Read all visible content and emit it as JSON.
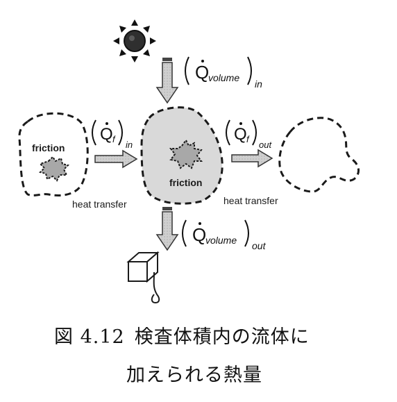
{
  "labels": {
    "friction_left": "friction",
    "friction_center": "friction",
    "heat_transfer_left": "heat transfer",
    "heat_transfer_right": "heat transfer"
  },
  "heat_flows": {
    "volume_in": {
      "symbol": "Q",
      "subscript": "volume",
      "outer_subscript": "in"
    },
    "friction_in": {
      "symbol": "Q",
      "subscript": "f",
      "outer_subscript": "in"
    },
    "friction_out": {
      "symbol": "Q",
      "subscript": "f",
      "outer_subscript": "out"
    },
    "volume_out": {
      "symbol": "Q",
      "subscript": "volume",
      "outer_subscript": "out"
    }
  },
  "caption": {
    "figure_number": "図 4.12",
    "line1": "検査体積内の流体に",
    "line2": "加えられる熱量"
  },
  "colors": {
    "control_volume_fill": "#d9d9d9",
    "friction_spot_fill": "#a8a8a8",
    "arrow_fill": "#c8c8c8",
    "outline": "#1a1a1a"
  },
  "icons": {
    "heat_source": "sun-icon",
    "volume_outflow": "box-with-drop-icon"
  }
}
